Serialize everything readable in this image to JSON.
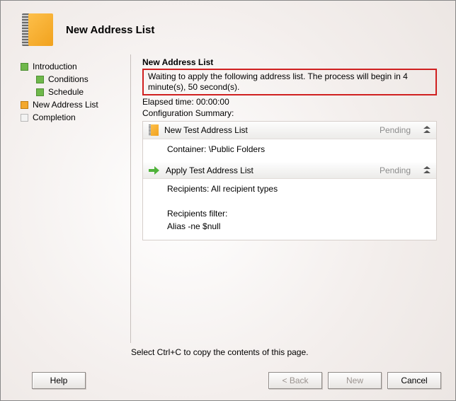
{
  "header": {
    "title": "New Address List"
  },
  "nav": {
    "items": [
      {
        "label": "Introduction",
        "state": "green",
        "indent": 0
      },
      {
        "label": "Conditions",
        "state": "green",
        "indent": 1
      },
      {
        "label": "Schedule",
        "state": "green",
        "indent": 1
      },
      {
        "label": "New Address List",
        "state": "orange",
        "indent": 0
      },
      {
        "label": "Completion",
        "state": "grey",
        "indent": 0
      }
    ]
  },
  "main": {
    "section_title": "New Address List",
    "waiting_message": "Waiting to apply the following address list. The process will begin in 4 minute(s), 50 second(s).",
    "elapsed_label": "Elapsed time:",
    "elapsed_value": "00:00:00",
    "config_summary_label": "Configuration Summary:",
    "panels": [
      {
        "icon": "book",
        "title": "New Test Address List",
        "status": "Pending",
        "body_lines": [
          "Container: \\Public Folders"
        ]
      },
      {
        "icon": "arrow",
        "title": "Apply Test Address List",
        "status": "Pending",
        "body_lines": [
          "Recipients: All recipient types",
          "",
          "Recipients filter:",
          "Alias -ne $null"
        ]
      }
    ],
    "copy_hint": "Select Ctrl+C to copy the contents of this page."
  },
  "buttons": {
    "help": "Help",
    "back": "< Back",
    "new": "New",
    "cancel": "Cancel"
  }
}
